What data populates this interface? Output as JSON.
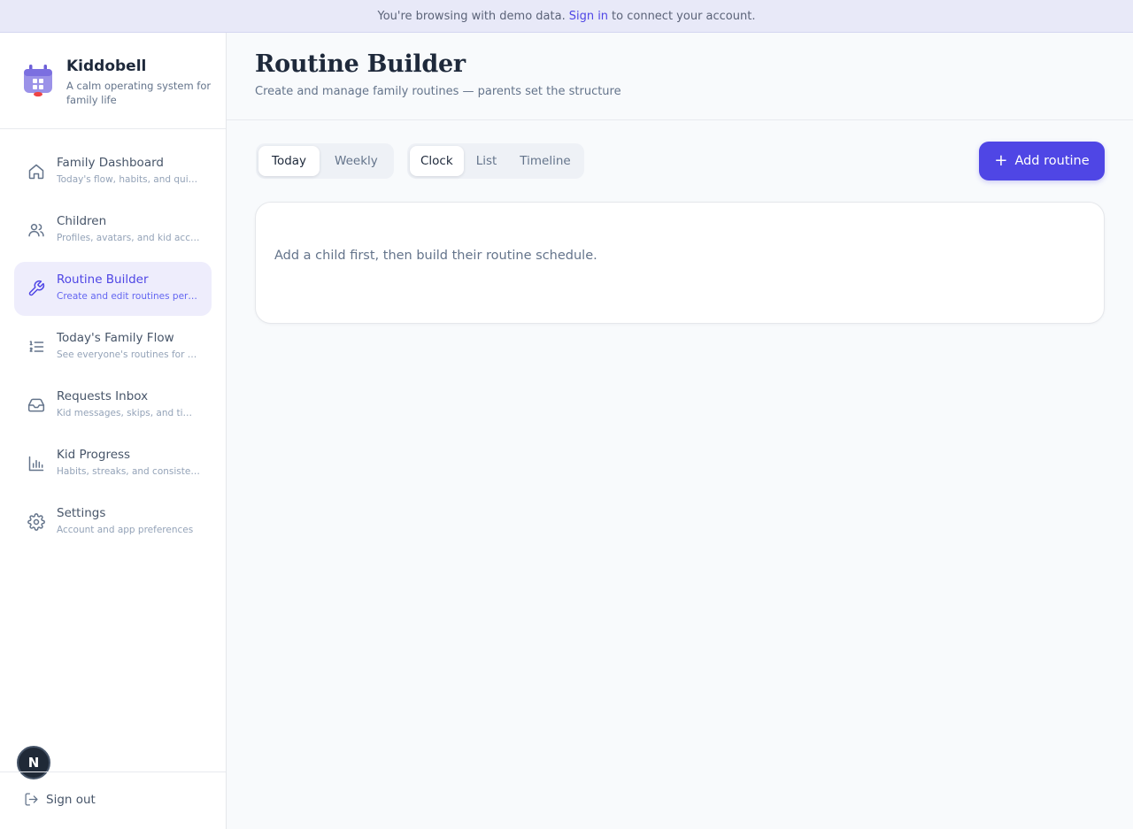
{
  "banner": {
    "before": "You're browsing with demo data.",
    "link": "Sign in",
    "after": "to connect your account."
  },
  "brand": {
    "name": "Kiddobell",
    "tagline": "A calm operating system for family life"
  },
  "nav": [
    {
      "label": "Family Dashboard",
      "desc": "Today's flow, habits, and quick actions",
      "icon": "home-icon",
      "active": false
    },
    {
      "label": "Children",
      "desc": "Profiles, avatars, and kid accounts",
      "icon": "users-icon",
      "active": false
    },
    {
      "label": "Routine Builder",
      "desc": "Create and edit routines per child",
      "icon": "wrench-icon",
      "active": true
    },
    {
      "label": "Today's Family Flow",
      "desc": "See everyone's routines for today",
      "icon": "list-ordered-icon",
      "active": false
    },
    {
      "label": "Requests Inbox",
      "desc": "Kid messages, skips, and time requests",
      "icon": "inbox-icon",
      "active": false
    },
    {
      "label": "Kid Progress",
      "desc": "Habits, streaks, and consistency",
      "icon": "bar-chart-icon",
      "active": false
    },
    {
      "label": "Settings",
      "desc": "Account and app preferences",
      "icon": "gear-icon",
      "active": false
    }
  ],
  "avatar_initial": "N",
  "signout_label": "Sign out",
  "page": {
    "title": "Routine Builder",
    "subtitle": "Create and manage family routines — parents set the structure"
  },
  "range_tabs": [
    {
      "label": "Today",
      "active": true
    },
    {
      "label": "Weekly",
      "active": false
    }
  ],
  "view_tabs": [
    {
      "label": "Clock",
      "active": true
    },
    {
      "label": "List",
      "active": false
    },
    {
      "label": "Timeline",
      "active": false
    }
  ],
  "add_button": {
    "label": "Add routine",
    "icon": "plus-icon"
  },
  "empty_message": "Add a child first, then build their routine schedule.",
  "colors": {
    "accent": "#4f46e5",
    "active_nav_bg": "#eeedfc",
    "banner_bg": "#e8e9f8"
  }
}
